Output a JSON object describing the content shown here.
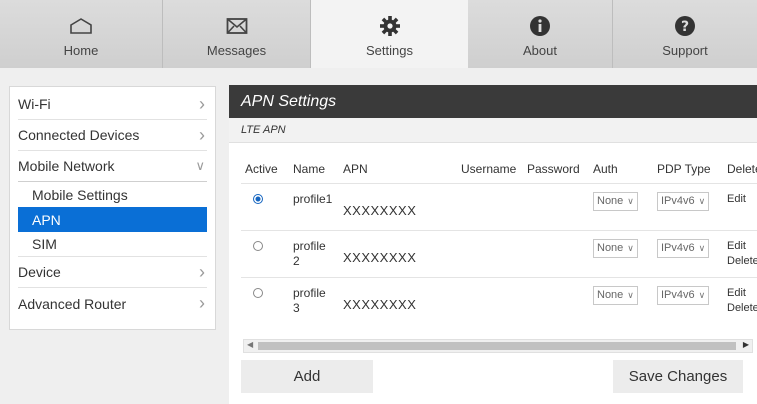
{
  "nav": {
    "tabs": [
      {
        "label": "Home",
        "icon": "home-icon"
      },
      {
        "label": "Messages",
        "icon": "envelope-icon"
      },
      {
        "label": "Settings",
        "icon": "gear-icon",
        "active": true
      },
      {
        "label": "About",
        "icon": "info-icon"
      },
      {
        "label": "Support",
        "icon": "question-icon"
      }
    ]
  },
  "sidebar": {
    "items": [
      {
        "label": "Wi-Fi"
      },
      {
        "label": "Connected Devices"
      },
      {
        "label": "Mobile Network",
        "expanded": true,
        "children": [
          "Mobile Settings",
          "APN",
          "SIM"
        ]
      },
      {
        "label": "Device"
      },
      {
        "label": "Advanced Router"
      }
    ],
    "active_child": "APN"
  },
  "main": {
    "title": "APN Settings",
    "subtitle": "LTE APN",
    "columns": [
      "Active",
      "Name",
      "APN",
      "Username",
      "Password",
      "Auth",
      "PDP Type",
      "Delete"
    ],
    "rows": [
      {
        "active": true,
        "name": "profile1",
        "apn": "XXXXXXXX",
        "auth": "None",
        "pdp": "IPv4v6",
        "actions": [
          "Edit"
        ]
      },
      {
        "active": false,
        "name": "profile 2",
        "apn": "XXXXXXXX",
        "auth": "None",
        "pdp": "IPv4v6",
        "actions": [
          "Edit",
          "Delete"
        ]
      },
      {
        "active": false,
        "name": "profile 3",
        "apn": "XXXXXXXX",
        "auth": "None",
        "pdp": "IPv4v6",
        "actions": [
          "Edit",
          "Delete"
        ]
      }
    ],
    "add_label": "Add",
    "save_label": "Save Changes"
  },
  "colors": {
    "accent": "#0a6fd6",
    "title_bar": "#3a3a3a"
  }
}
